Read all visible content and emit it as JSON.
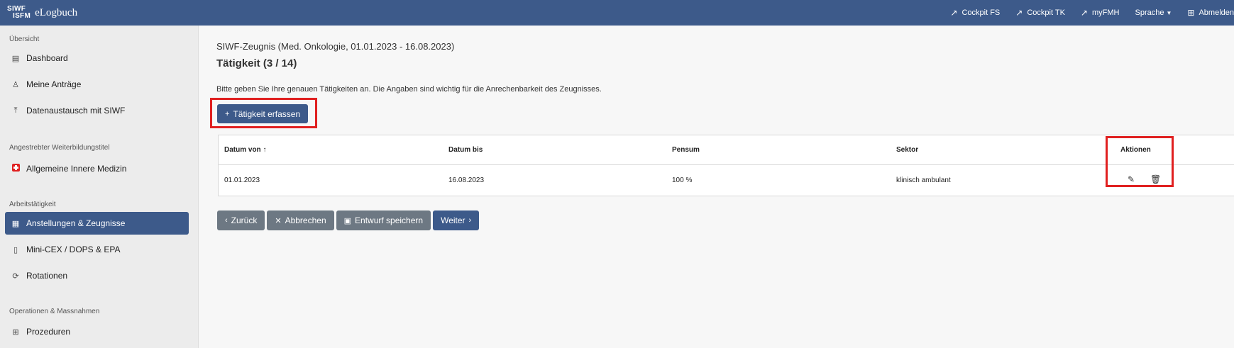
{
  "header": {
    "logo_line1": "SIWF",
    "logo_line2": "ISFM",
    "app_name": "eLogbuch",
    "nav": [
      {
        "label": "Cockpit FS"
      },
      {
        "label": "Cockpit TK"
      },
      {
        "label": "myFMH"
      },
      {
        "label": "Sprache"
      },
      {
        "label": "Abmelden"
      }
    ]
  },
  "sidebar": {
    "sections": [
      {
        "label": "Übersicht",
        "items": [
          {
            "label": "Dashboard",
            "icon": "dashboard-icon"
          },
          {
            "label": "Meine Anträge",
            "icon": "stamp-icon"
          },
          {
            "label": "Datenaustausch mit SIWF",
            "icon": "upload-icon"
          }
        ]
      },
      {
        "label": "Angestrebter Weiterbildungstitel",
        "items": [
          {
            "label": "Allgemeine Innere Medizin",
            "icon": "swiss-cross-icon"
          }
        ]
      },
      {
        "label": "Arbeitstätigkeit",
        "items": [
          {
            "label": "Anstellungen & Zeugnisse",
            "icon": "building-icon",
            "active": true
          },
          {
            "label": "Mini-CEX / DOPS & EPA",
            "icon": "clipboard-icon"
          },
          {
            "label": "Rotationen",
            "icon": "rotate-icon"
          }
        ]
      },
      {
        "label": "Operationen & Massnahmen",
        "items": [
          {
            "label": "Prozeduren",
            "icon": "plus-square-icon"
          }
        ]
      }
    ]
  },
  "main": {
    "subtitle": "SIWF-Zeugnis (Med. Onkologie, 01.01.2023 - 16.08.2023)",
    "title": "Tätigkeit (3 / 14)",
    "intro": "Bitte geben Sie Ihre genauen Tätigkeiten an. Die Angaben sind wichtig für die Anrechenbarkeit des Zeugnisses.",
    "add_button": "Tätigkeit erfassen",
    "table": {
      "headers": [
        "Datum von",
        "Datum bis",
        "Pensum",
        "Sektor",
        "Aktionen"
      ],
      "sort_indicator": "↑",
      "rows": [
        {
          "von": "01.01.2023",
          "bis": "16.08.2023",
          "pensum": "100 %",
          "sektor": "klinisch ambulant"
        }
      ]
    },
    "buttons": {
      "back": "Zurück",
      "cancel": "Abbrechen",
      "save_draft": "Entwurf speichern",
      "next": "Weiter"
    }
  },
  "colors": {
    "brand": "#3d5a8a",
    "secondary": "#6d7883",
    "highlight": "#e02020"
  }
}
